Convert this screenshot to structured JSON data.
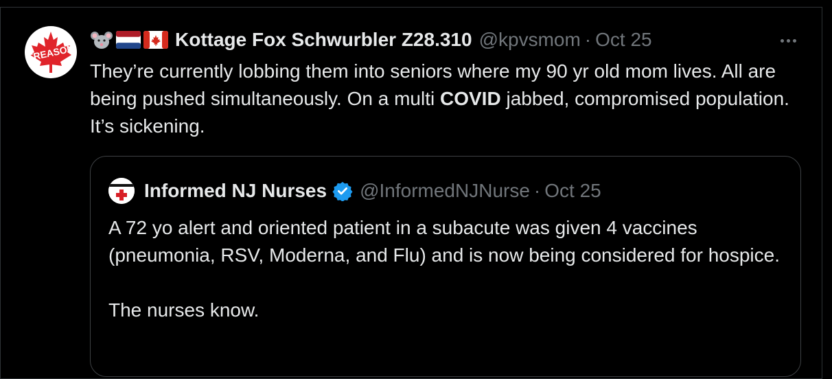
{
  "tweet": {
    "avatar_text": "TREASON",
    "emoji_icons": [
      "mouse-face-icon",
      "netherlands-flag-icon",
      "canada-flag-icon"
    ],
    "name": "Kottage Fox Schwurbler Z28.310",
    "handle": "@kpvsmom",
    "separator": "·",
    "date": "Oct 25",
    "text_before_bold": "They’re currently lobbing them into seniors where my 90 yr old mom lives. All are being pushed simultaneously. On a multi ",
    "text_bold": "COVID",
    "text_after_bold": " jabbed, compromised population. It’s sickening.",
    "colors": {
      "background": "#000000",
      "text": "#e7e9ea",
      "muted": "#71767b",
      "maple_red": "#e0242b"
    }
  },
  "quoted_tweet": {
    "name": "Informed NJ Nurses",
    "verified": true,
    "handle": "@InformedNJNurse",
    "separator": "·",
    "date": "Oct 25",
    "paragraph_1": "A 72 yo alert and oriented patient in a subacute was given 4 vaccines (pneumonia, RSV, Moderna, and Flu) and is now being considered for hospice.",
    "paragraph_2": "The nurses know.",
    "colors": {
      "verified_blue": "#1d9bf0",
      "cross_red": "#d81f26"
    }
  }
}
